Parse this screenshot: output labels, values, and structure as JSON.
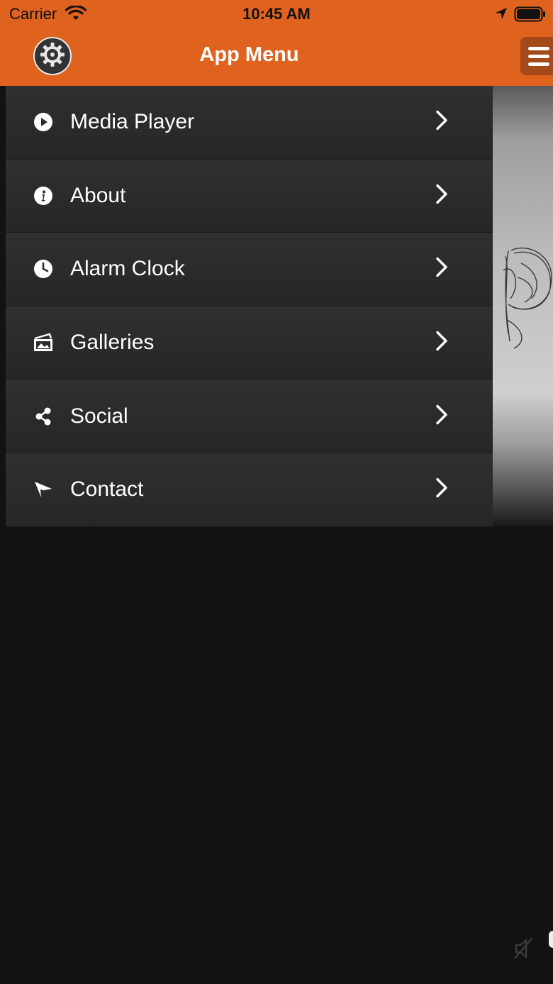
{
  "status_bar": {
    "carrier": "Carrier",
    "time": "10:45 AM"
  },
  "header": {
    "title": "App Menu",
    "settings_icon": "gear-icon",
    "menu_icon": "hamburger-icon",
    "background_color": "#df621e"
  },
  "menu": {
    "items": [
      {
        "label": "Media Player",
        "icon": "play-icon"
      },
      {
        "label": "About",
        "icon": "info-icon"
      },
      {
        "label": "Alarm Clock",
        "icon": "clock-icon"
      },
      {
        "label": "Galleries",
        "icon": "gallery-icon"
      },
      {
        "label": "Social",
        "icon": "share-icon"
      },
      {
        "label": "Contact",
        "icon": "send-icon"
      }
    ]
  },
  "footer": {
    "mute_icon": "muted-speaker-icon"
  }
}
